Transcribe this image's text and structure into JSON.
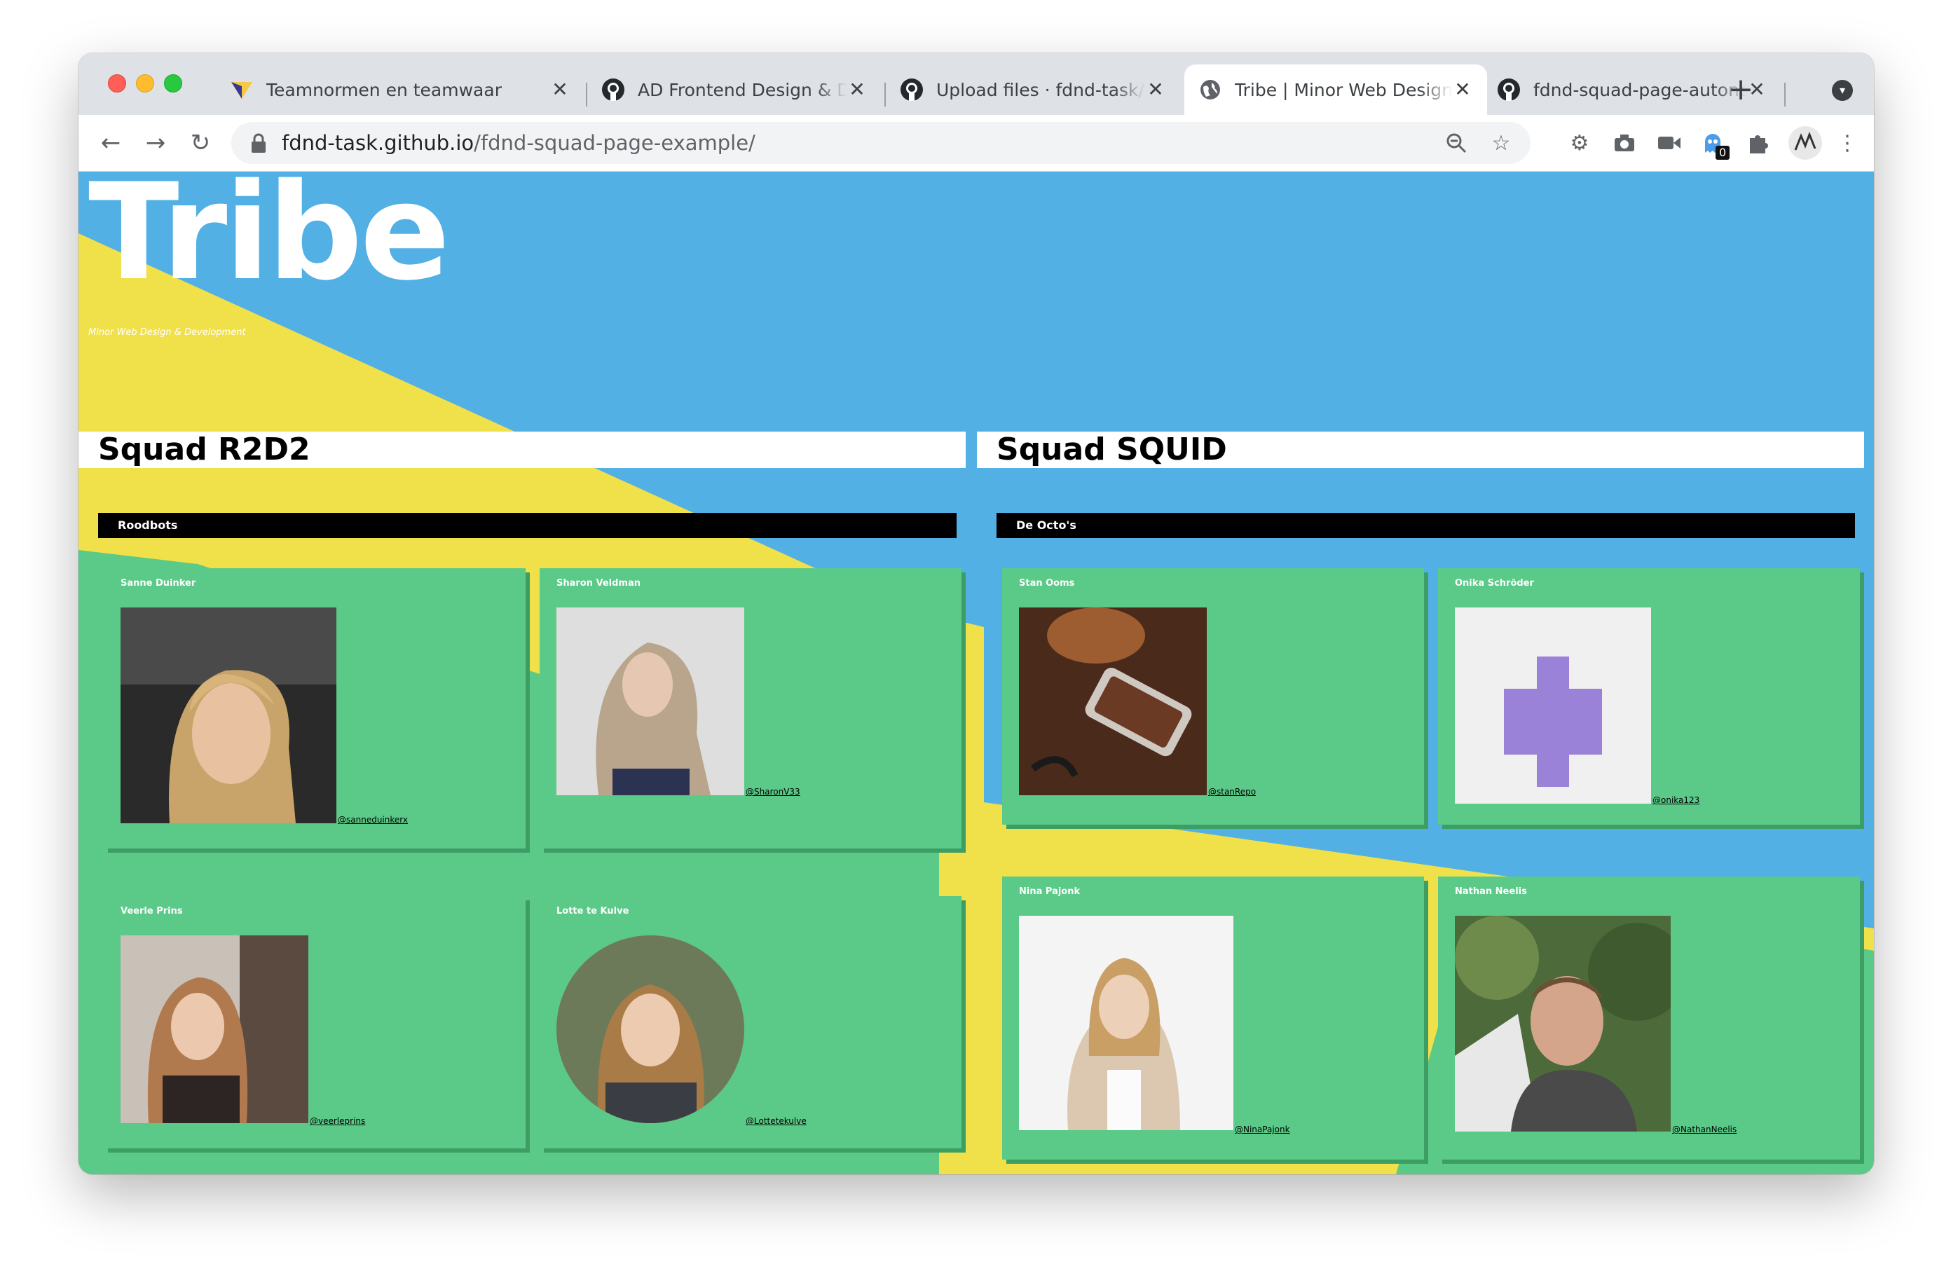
{
  "browser": {
    "tabs": [
      {
        "title": "Teamnormen en teamwaar",
        "icon": "task-app-icon",
        "active": false
      },
      {
        "title": "AD Frontend Design & Dev",
        "icon": "github-icon",
        "active": false
      },
      {
        "title": "Upload files · fdnd-task/fd",
        "icon": "github-icon",
        "active": false
      },
      {
        "title": "Tribe | Minor Web Design &",
        "icon": "globe-icon",
        "active": true
      },
      {
        "title": "fdnd-squad-page-autonor",
        "icon": "github-icon",
        "active": false
      }
    ],
    "close_glyph": "✕",
    "new_tab_glyph": "+",
    "url_host": "fdnd-task.github.io",
    "url_path": "/fdnd-squad-page-example/",
    "extension_badge": "0"
  },
  "site": {
    "title": "Tribe",
    "subtitle": "Minor Web Design & Development",
    "colors": {
      "sky": "#52b0e5",
      "yellow": "#f0e14a",
      "green": "#5bc987",
      "white": "#ffffff",
      "black": "#000000"
    }
  },
  "squads": [
    {
      "name": "Squad R2D2",
      "team": "Roodbots",
      "members": [
        {
          "name": "Sanne Duinker",
          "handle": "@sanneduinkerx"
        },
        {
          "name": "Sharon Veldman",
          "handle": "@SharonV33"
        },
        {
          "name": "Veerle Prins",
          "handle": "@veerleprins"
        },
        {
          "name": "Lotte te Kulve",
          "handle": "@Lottetekulve"
        }
      ]
    },
    {
      "name": "Squad SQUID",
      "team": "De Octo's",
      "members": [
        {
          "name": "Stan Ooms",
          "handle": "@stanRepo"
        },
        {
          "name": "Onika Schröder",
          "handle": "@onika123"
        },
        {
          "name": "Nina Pajonk",
          "handle": "@NinaPajonk"
        },
        {
          "name": "Nathan Neelis",
          "handle": "@NathanNeelis"
        }
      ]
    }
  ]
}
